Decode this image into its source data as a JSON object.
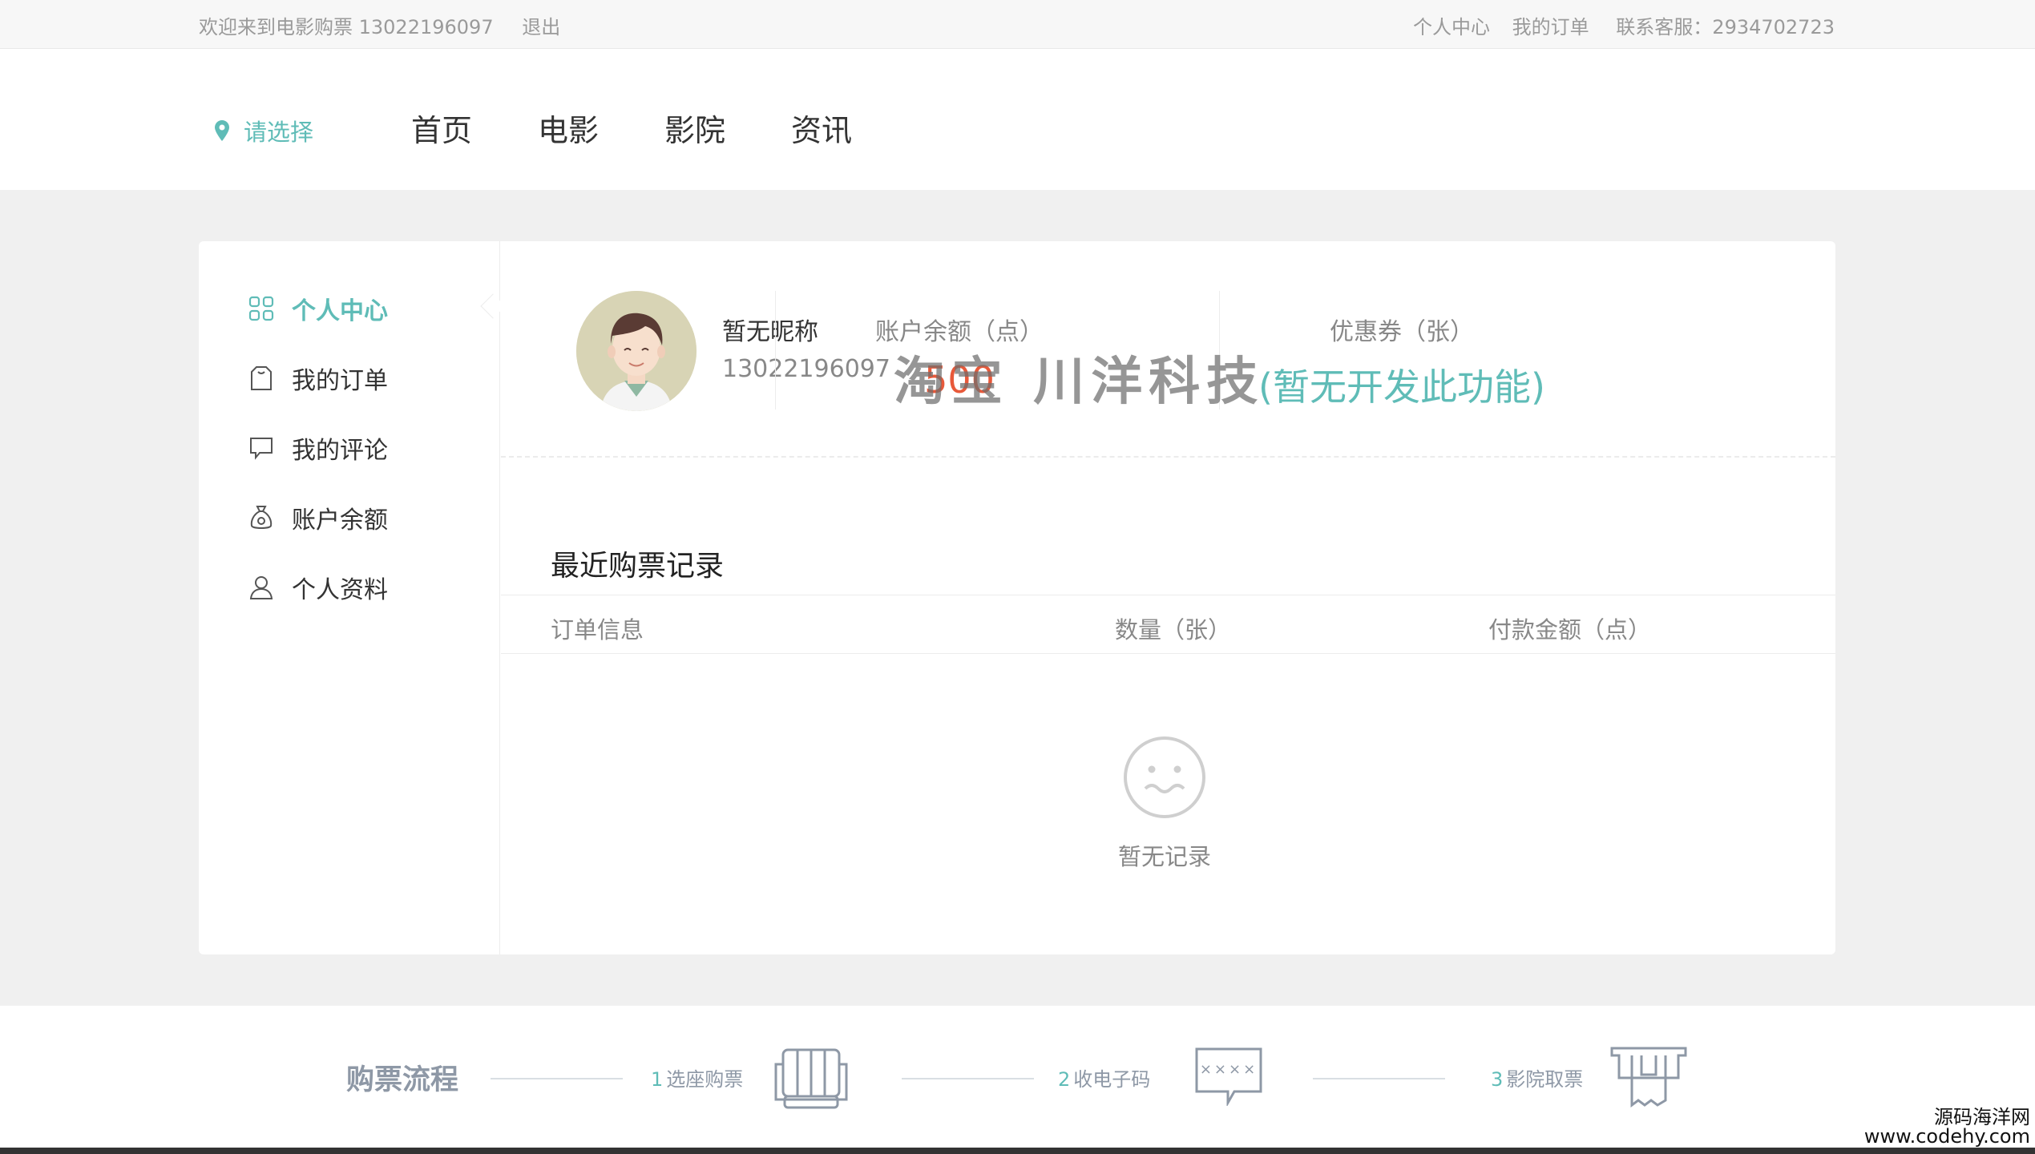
{
  "topbar": {
    "welcome": "欢迎来到电影购票 13022196097",
    "logout": "退出",
    "personal_center": "个人中心",
    "my_orders": "我的订单",
    "service": "联系客服：2934702723"
  },
  "header": {
    "city": "请选择",
    "nav": [
      "首页",
      "电影",
      "影院",
      "资讯"
    ]
  },
  "sidebar": {
    "items": [
      {
        "label": "个人中心",
        "icon": "grid-icon",
        "active": true
      },
      {
        "label": "我的订单",
        "icon": "bag-icon",
        "active": false
      },
      {
        "label": "我的评论",
        "icon": "comment-icon",
        "active": false
      },
      {
        "label": "账户余额",
        "icon": "money-bag-icon",
        "active": false
      },
      {
        "label": "个人资料",
        "icon": "user-icon",
        "active": false
      }
    ]
  },
  "profile": {
    "nickname": "暂无昵称",
    "phone": "13022196097",
    "balance_label": "账户余额（点）",
    "balance_value": "500",
    "coupon_label": "优惠券（张）",
    "coupon_value": "(暂无开发此功能)"
  },
  "watermark": "淘宝 川洋科技",
  "records": {
    "title": "最近购票记录",
    "columns": [
      "订单信息",
      "数量（张）",
      "付款金额（点）"
    ],
    "empty_text": "暂无记录"
  },
  "process": {
    "title": "购票流程",
    "steps": [
      {
        "num": "1",
        "label": "选座购票"
      },
      {
        "num": "2",
        "label": "收电子码"
      },
      {
        "num": "3",
        "label": "影院取票"
      }
    ],
    "code_text": "××××"
  },
  "brand": {
    "line1": "源码海洋网",
    "line2": "www.codehy.com"
  },
  "colors": {
    "accent": "#5fbcb7",
    "balance": "#e8593a",
    "background": "#f0f0f0"
  }
}
